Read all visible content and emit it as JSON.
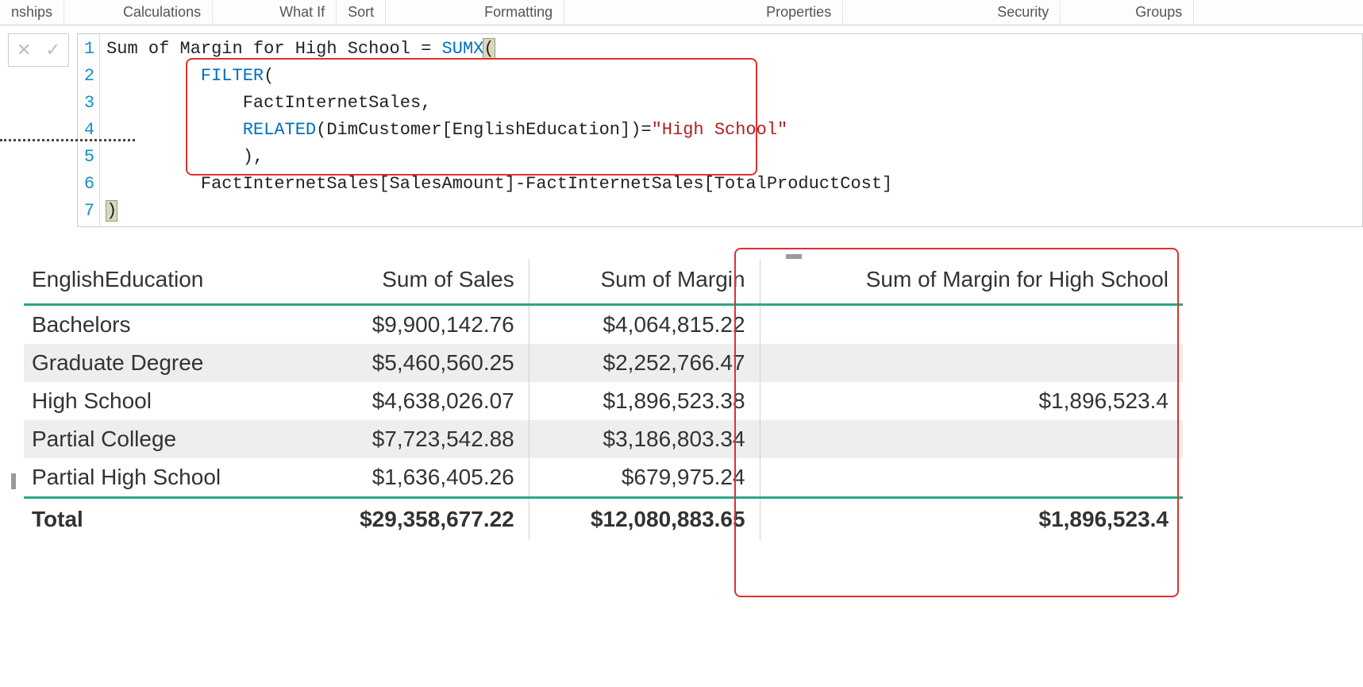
{
  "ribbon": {
    "tabs": [
      "nships",
      "Calculations",
      "What If",
      "Sort",
      "Formatting",
      "Properties",
      "Security",
      "Groups"
    ]
  },
  "formula": {
    "line_numbers": [
      "1",
      "2",
      "3",
      "4",
      "5",
      "6",
      "7"
    ],
    "l1_a": "Sum of Margin for High School = ",
    "l1_fn": "SUMX",
    "l1_b": "(",
    "l2_fn": "FILTER",
    "l2_b": "(",
    "l3": "FactInternetSales,",
    "l4_fn": "RELATED",
    "l4_a": "(DimCustomer[EnglishEducation])=",
    "l4_str": "\"High School\"",
    "l5": "),",
    "l6": "FactInternetSales[SalesAmount]-FactInternetSales[TotalProductCost]",
    "l7": ")"
  },
  "table": {
    "headers": [
      "EnglishEducation",
      "Sum of Sales",
      "Sum of Margin",
      "Sum of Margin for High School"
    ],
    "rows": [
      {
        "label": "Bachelors",
        "sales": "$9,900,142.76",
        "margin": "$4,064,815.22",
        "hs": ""
      },
      {
        "label": "Graduate Degree",
        "sales": "$5,460,560.25",
        "margin": "$2,252,766.47",
        "hs": ""
      },
      {
        "label": "High School",
        "sales": "$4,638,026.07",
        "margin": "$1,896,523.38",
        "hs": "$1,896,523.4"
      },
      {
        "label": "Partial College",
        "sales": "$7,723,542.88",
        "margin": "$3,186,803.34",
        "hs": ""
      },
      {
        "label": "Partial High School",
        "sales": "$1,636,405.26",
        "margin": "$679,975.24",
        "hs": ""
      }
    ],
    "total": {
      "label": "Total",
      "sales": "$29,358,677.22",
      "margin": "$12,080,883.65",
      "hs": "$1,896,523.4"
    }
  }
}
